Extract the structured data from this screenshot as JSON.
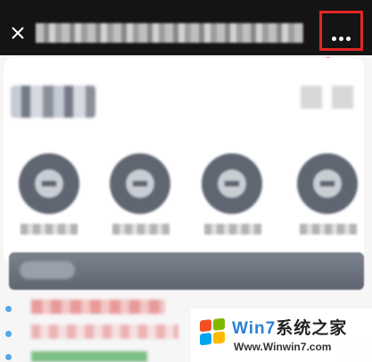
{
  "colors": {
    "top_bar": "#141414",
    "highlight_box": "#e32626",
    "arrow": "#e32626",
    "page_background": "#f6f6f7"
  },
  "top_bar": {
    "close_icon": "close-icon",
    "title": "",
    "more_icon": "more-dots-icon"
  },
  "watermark": {
    "brand_line": "Win7系统之家",
    "brand_w7": "Win7",
    "brand_rest": "系统之家",
    "url": "Www.Winwin7.com"
  }
}
